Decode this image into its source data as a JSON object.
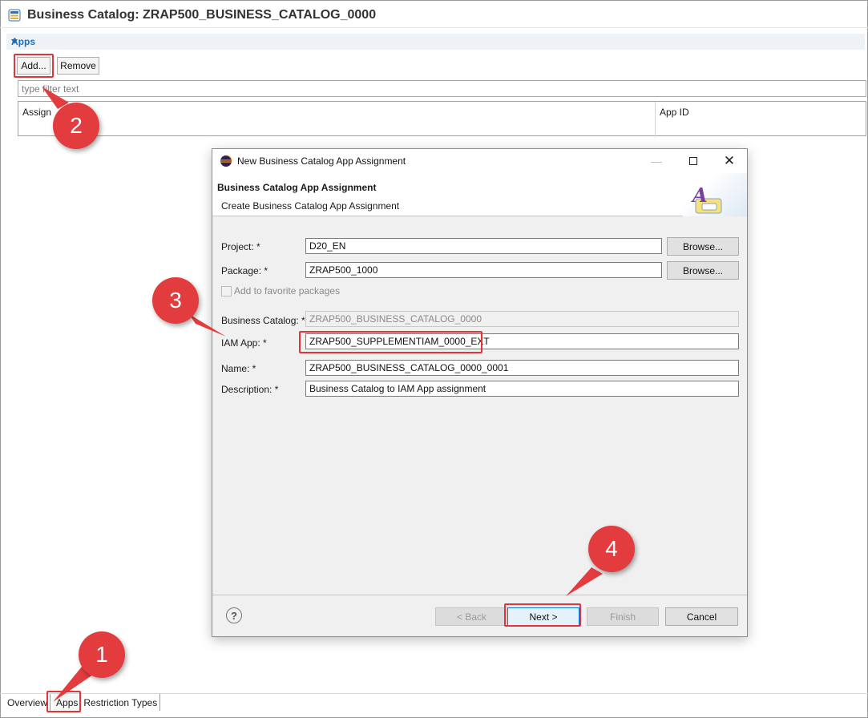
{
  "editor": {
    "title": "Business Catalog: ZRAP500_BUSINESS_CATALOG_0000",
    "section_title": "Apps",
    "add_button": "Add...",
    "remove_button": "Remove",
    "filter_placeholder": "type filter text",
    "table_columns": [
      "Assign",
      "App ID"
    ]
  },
  "bottom_tabs": [
    "Overview",
    "Apps",
    "Restriction Types"
  ],
  "dialog": {
    "window_title": "New Business Catalog App Assignment",
    "heading": "Business Catalog App Assignment",
    "subheading": "Create Business Catalog App Assignment",
    "fields": {
      "project_label": "Project: *",
      "project_value": "D20_EN",
      "package_label": "Package: *",
      "package_value": "ZRAP500_1000",
      "browse_label": "Browse...",
      "favorite_label": "Add to favorite packages",
      "business_catalog_label": "Business Catalog: *",
      "business_catalog_value": "ZRAP500_BUSINESS_CATALOG_0000",
      "iam_app_label": "IAM App: *",
      "iam_app_value": "ZRAP500_SUPPLEMENTIAM_0000_EXT",
      "name_label": "Name: *",
      "name_value": "ZRAP500_BUSINESS_CATALOG_0000_0001",
      "description_label": "Description: *",
      "description_value": "Business Catalog to IAM App assignment"
    },
    "buttons": {
      "back": "< Back",
      "next": "Next >",
      "finish": "Finish",
      "cancel": "Cancel",
      "help": "?"
    }
  },
  "annotations": {
    "steps": [
      "1",
      "2",
      "3",
      "4"
    ],
    "color": "#e23c3f"
  }
}
